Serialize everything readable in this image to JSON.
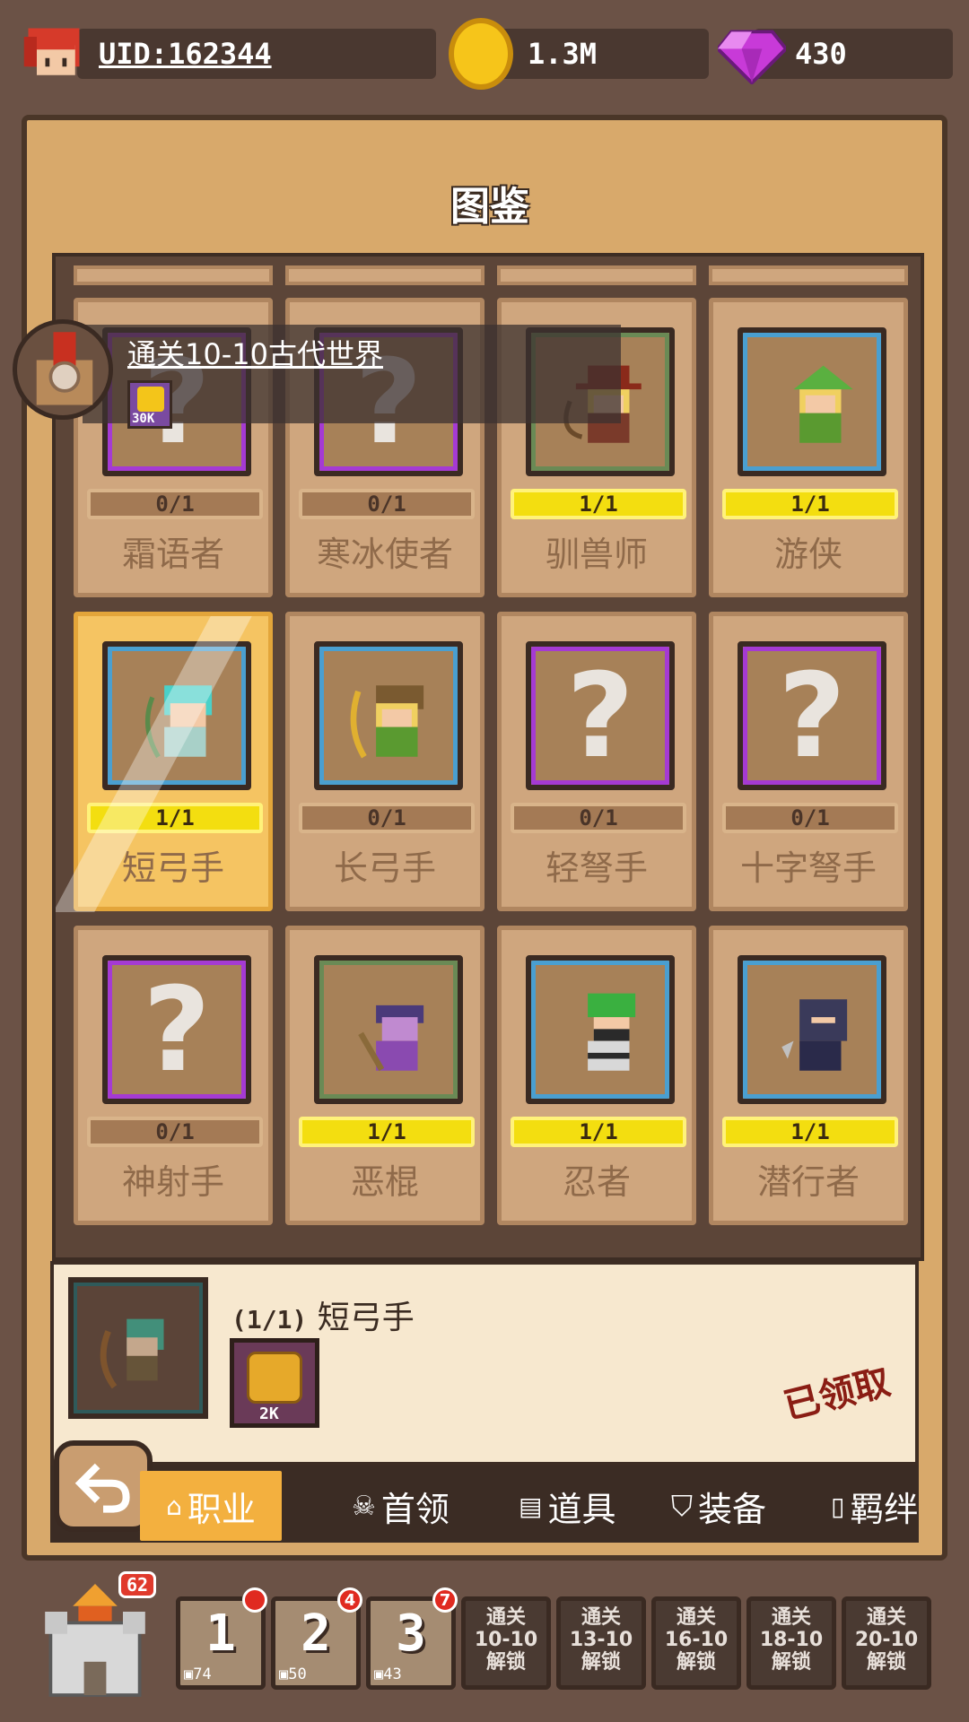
{
  "topbar": {
    "uid": "UID:162344",
    "coins": "1.3M",
    "gems": "430"
  },
  "panel": {
    "title": "图鉴"
  },
  "tooltip": {
    "text": "通关10-10古代世界",
    "reward": "30K"
  },
  "cards": [
    {
      "name": "霜语者",
      "progress": "0/1",
      "unlocked": false,
      "frame": "#a53ad3"
    },
    {
      "name": "寒冰使者",
      "progress": "0/1",
      "unlocked": false,
      "frame": "#a53ad3"
    },
    {
      "name": "驯兽师",
      "progress": "1/1",
      "unlocked": true,
      "frame": "#6a8a55"
    },
    {
      "name": "游侠",
      "progress": "1/1",
      "unlocked": true,
      "frame": "#4a9fd0"
    },
    {
      "name": "短弓手",
      "progress": "1/1",
      "unlocked": true,
      "frame": "#4a9fd0"
    },
    {
      "name": "长弓手",
      "progress": "0/1",
      "unlocked": true,
      "frame": "#4a9fd0"
    },
    {
      "name": "轻弩手",
      "progress": "0/1",
      "unlocked": false,
      "frame": "#a53ad3"
    },
    {
      "name": "十字弩手",
      "progress": "0/1",
      "unlocked": false,
      "frame": "#a53ad3"
    },
    {
      "name": "神射手",
      "progress": "0/1",
      "unlocked": false,
      "frame": "#a53ad3"
    },
    {
      "name": "恶棍",
      "progress": "1/1",
      "unlocked": true,
      "frame": "#6a8a55"
    },
    {
      "name": "忍者",
      "progress": "1/1",
      "unlocked": true,
      "frame": "#4a9fd0"
    },
    {
      "name": "潜行者",
      "progress": "1/1",
      "unlocked": true,
      "frame": "#4a9fd0"
    }
  ],
  "detail": {
    "level": "(1/1)",
    "name": "短弓手",
    "reward": "2K",
    "status": "已领取"
  },
  "tabs": [
    {
      "label": "职业",
      "active": true
    },
    {
      "label": "首领",
      "active": false
    },
    {
      "label": "道具",
      "active": false
    },
    {
      "label": "装备",
      "active": false
    },
    {
      "label": "羁绊",
      "active": false
    }
  ],
  "bottom": {
    "castle_level": "62",
    "slots": [
      {
        "num": "1",
        "count": "74",
        "badge": ""
      },
      {
        "num": "2",
        "count": "50",
        "badge": "4"
      },
      {
        "num": "3",
        "count": "43",
        "badge": "7"
      }
    ],
    "locked": [
      [
        "通关",
        "10-10",
        "解锁"
      ],
      [
        "通关",
        "13-10",
        "解锁"
      ],
      [
        "通关",
        "16-10",
        "解锁"
      ],
      [
        "通关",
        "18-10",
        "解锁"
      ],
      [
        "通关",
        "20-10",
        "解锁"
      ]
    ]
  },
  "colors": {
    "accent": "#f3b03f",
    "progress_full": "#f3de10",
    "claimed": "#8a1d14"
  }
}
